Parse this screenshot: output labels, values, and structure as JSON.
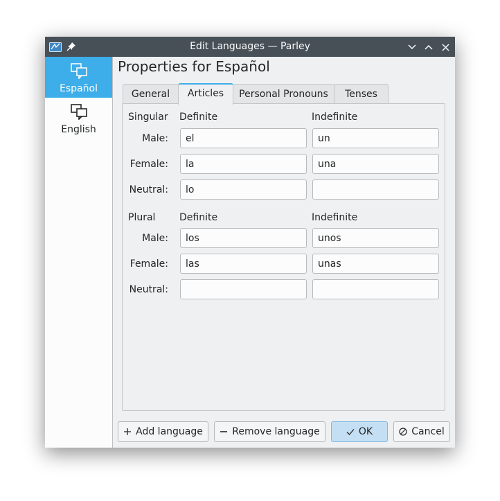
{
  "window": {
    "title": "Edit Languages — Parley"
  },
  "sidebar": {
    "items": [
      {
        "label": "Español",
        "active": true
      },
      {
        "label": "English",
        "active": false
      }
    ]
  },
  "main": {
    "heading": "Properties for Español",
    "tabs": [
      {
        "label": "General"
      },
      {
        "label": "Articles",
        "active": true
      },
      {
        "label": "Personal Pronouns"
      },
      {
        "label": "Tenses"
      }
    ],
    "articles": {
      "singular": {
        "label": "Singular",
        "definite_label": "Definite",
        "indefinite_label": "Indefinite",
        "rows": [
          {
            "label": "Male:",
            "definite": "el",
            "indefinite": "un"
          },
          {
            "label": "Female:",
            "definite": "la",
            "indefinite": "una"
          },
          {
            "label": "Neutral:",
            "definite": "lo",
            "indefinite": ""
          }
        ]
      },
      "plural": {
        "label": "Plural",
        "definite_label": "Definite",
        "indefinite_label": "Indefinite",
        "rows": [
          {
            "label": "Male:",
            "definite": "los",
            "indefinite": "unos"
          },
          {
            "label": "Female:",
            "definite": "las",
            "indefinite": "unas"
          },
          {
            "label": "Neutral:",
            "definite": "",
            "indefinite": ""
          }
        ]
      }
    }
  },
  "buttons": {
    "add": "Add language",
    "remove": "Remove language",
    "ok": "OK",
    "cancel": "Cancel"
  },
  "colors": {
    "accent": "#3daee9",
    "titlebar": "#475057",
    "window_bg": "#eff0f1"
  }
}
